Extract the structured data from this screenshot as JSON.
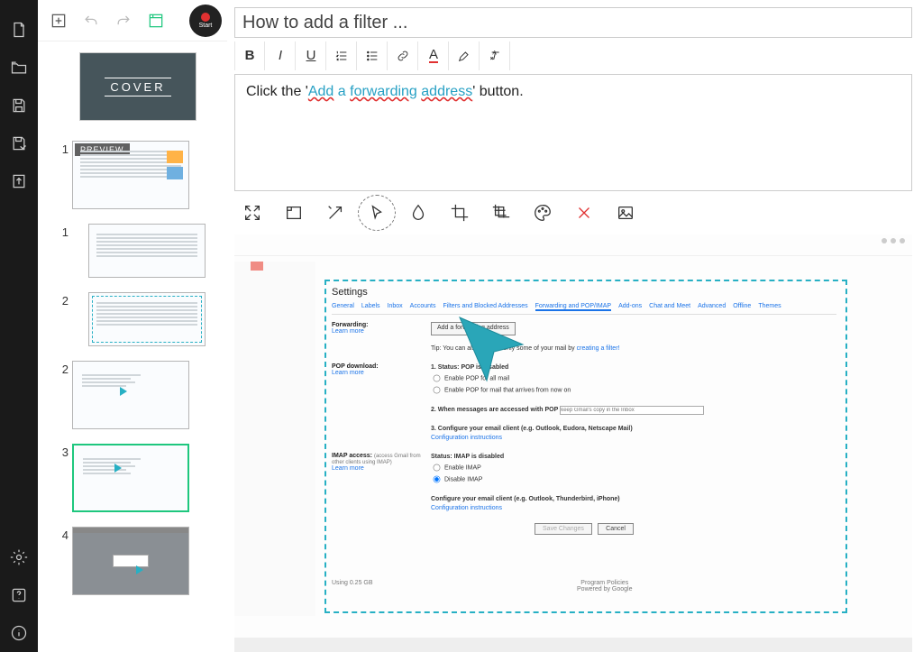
{
  "iconbar": {
    "new_doc": "new-doc",
    "open": "open",
    "save": "save",
    "save_as": "save-as",
    "export": "export",
    "settings": "settings",
    "help": "help",
    "info": "info"
  },
  "thumb_toolbar": {
    "add": "add-step",
    "undo": "undo",
    "redo": "redo",
    "screenshot": "screenshot",
    "start_label": "Start"
  },
  "cover_label": "COVER",
  "preview_badge": "PREVIEW",
  "steps": [
    {
      "num": "1",
      "type": "overview",
      "badge": true,
      "selected": false,
      "section": false
    },
    {
      "num": "1",
      "type": "list",
      "badge": false,
      "selected": false,
      "section": true
    },
    {
      "num": "2",
      "type": "list-dashed",
      "badge": false,
      "selected": false,
      "section": true
    },
    {
      "num": "2",
      "type": "click",
      "badge": false,
      "selected": false,
      "section": false
    },
    {
      "num": "3",
      "type": "settings",
      "badge": false,
      "selected": true,
      "section": false
    },
    {
      "num": "4",
      "type": "dialog",
      "badge": false,
      "selected": false,
      "section": false
    }
  ],
  "title_placeholder": "How to add a filter ...",
  "format_bar": {
    "bold": "B",
    "italic": "I",
    "underline": "U",
    "ol": "ol",
    "ul": "ul",
    "link": "link",
    "color": "A",
    "highlight": "highlight",
    "clear": "clear"
  },
  "description": {
    "prefix": "Click the '",
    "link_text": "Add a forwarding address",
    "suffix": "' button."
  },
  "img_tools": {
    "expand": "expand",
    "rect": "rect",
    "arrow-off": "arrow-off",
    "cursor": "cursor",
    "blur": "blur",
    "crop": "crop",
    "multi-crop": "multi-crop",
    "palette": "palette",
    "delete": "delete",
    "image": "image"
  },
  "gmail": {
    "header": "Settings",
    "tabs": [
      "General",
      "Labels",
      "Inbox",
      "Accounts",
      "Filters and Blocked Addresses",
      "Forwarding and POP/IMAP",
      "Add-ons",
      "Chat and Meet",
      "Advanced",
      "Offline",
      "Themes"
    ],
    "active_tab": "Forwarding and POP/IMAP",
    "forwarding": {
      "label": "Forwarding:",
      "learn": "Learn more",
      "button": "Add a forwarding address",
      "tip_prefix": "Tip: You can also forward only some of your mail by ",
      "tip_link": "creating a filter!"
    },
    "pop": {
      "label": "POP download:",
      "learn": "Learn more",
      "status": "1. Status: POP is disabled",
      "opt1": "Enable POP for all mail",
      "opt2": "Enable POP for mail that arrives from now on",
      "when": "2. When messages are accessed with POP",
      "when_placeholder": "keep Gmail's copy in the Inbox",
      "configure": "3. Configure your email client (e.g. Outlook, Eudora, Netscape Mail)",
      "conf_link": "Configuration instructions"
    },
    "imap": {
      "label": "IMAP access:",
      "sub": "(access Gmail from other clients using IMAP)",
      "learn": "Learn more",
      "status": "Status: IMAP is disabled",
      "opt1": "Enable IMAP",
      "opt2": "Disable IMAP",
      "configure": "Configure your email client (e.g. Outlook, Thunderbird, iPhone)",
      "conf_link": "Configuration instructions"
    },
    "footer": {
      "save": "Save Changes",
      "cancel": "Cancel"
    },
    "foot2": {
      "usage": "Using 0.25 GB",
      "policy": "Program Policies",
      "powered": "Powered by Google"
    }
  }
}
